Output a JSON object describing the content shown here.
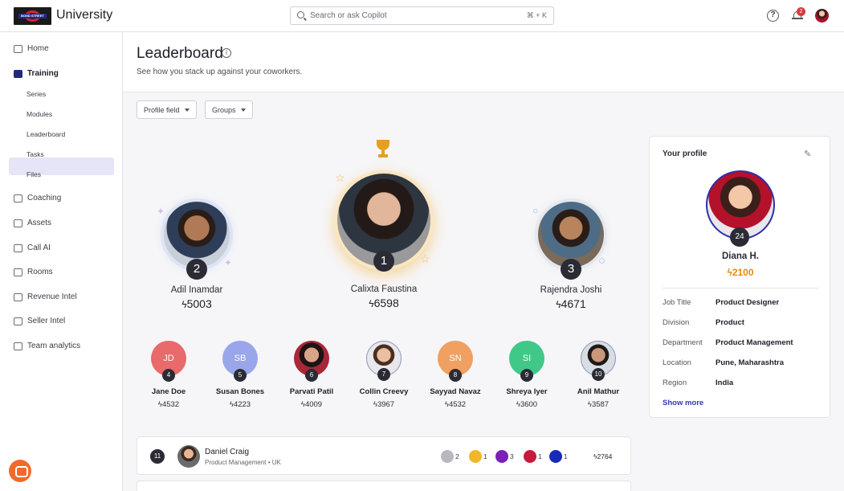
{
  "app": {
    "logo_text": "BOND STREET",
    "title": "University"
  },
  "search": {
    "placeholder": "Search or ask Copilot",
    "shortcut": "⌘ + K"
  },
  "header": {
    "notifications_count": "2",
    "help_label": "?"
  },
  "sidebar": {
    "items": [
      {
        "label": "Home",
        "icon": "home-icon"
      },
      {
        "label": "Training",
        "icon": "graduation-cap-icon"
      },
      {
        "label": "Coaching",
        "icon": "coaching-icon"
      },
      {
        "label": "Assets",
        "icon": "file-icon"
      },
      {
        "label": "Call AI",
        "icon": "audio-wave-icon"
      },
      {
        "label": "Rooms",
        "icon": "door-icon"
      },
      {
        "label": "Revenue Intel",
        "icon": "chart-icon"
      },
      {
        "label": "Seller Intel",
        "icon": "id-card-icon"
      },
      {
        "label": "Team analytics",
        "icon": "bar-chart-icon"
      }
    ],
    "training_sub": [
      "Series",
      "Modules",
      "Leaderboard",
      "Tasks",
      "Files"
    ]
  },
  "page": {
    "title": "Leaderboard",
    "subtitle": "See how you stack up against your coworkers."
  },
  "filters": {
    "profile_field": "Profile field",
    "groups": "Groups"
  },
  "podium": [
    {
      "rank": "2",
      "name": "Adil Inamdar",
      "score": "5003"
    },
    {
      "rank": "1",
      "name": "Calixta Faustina",
      "score": "6598"
    },
    {
      "rank": "3",
      "name": "Rajendra Joshi",
      "score": "4671"
    }
  ],
  "ranked": [
    {
      "rank": "4",
      "initials": "JD",
      "name": "Jane Doe",
      "score": "4532",
      "color": "#e86a6a"
    },
    {
      "rank": "5",
      "initials": "SB",
      "name": "Susan Bones",
      "score": "4223",
      "color": "#9aa6ea"
    },
    {
      "rank": "6",
      "initials": "",
      "name": "Parvati Patil",
      "score": "4009",
      "color": "#7a2a3a"
    },
    {
      "rank": "7",
      "initials": "",
      "name": "Collin Creevy",
      "score": "3967",
      "color": "#c9a58a"
    },
    {
      "rank": "8",
      "initials": "SN",
      "name": "Sayyad Navaz",
      "score": "4532",
      "color": "#f0a060"
    },
    {
      "rank": "9",
      "initials": "SI",
      "name": "Shreya Iyer",
      "score": "3600",
      "color": "#40c888"
    },
    {
      "rank": "10",
      "initials": "",
      "name": "Anil Mathur",
      "score": "3587",
      "color": "#5a6a7a"
    }
  ],
  "list_row": {
    "rank": "11",
    "name": "Daniel Craig",
    "department": "Product Management",
    "separator": "•",
    "region": "UK",
    "medals": [
      {
        "count": "2",
        "color": "#b8b8c0"
      },
      {
        "count": "1",
        "color": "#f0b829"
      },
      {
        "count": "3",
        "color": "#7a1fb8"
      },
      {
        "count": "1",
        "color": "#c81a3a"
      },
      {
        "count": "1",
        "color": "#1a2ab8"
      }
    ],
    "score": "2764"
  },
  "profile": {
    "title": "Your profile",
    "rank": "24",
    "name": "Diana H.",
    "score": "2100",
    "fields": [
      {
        "label": "Job Title",
        "value": "Product Designer"
      },
      {
        "label": "Division",
        "value": "Product"
      },
      {
        "label": "Department",
        "value": "Product Management"
      },
      {
        "label": "Location",
        "value": "Pune, Maharashtra"
      },
      {
        "label": "Region",
        "value": "India"
      }
    ],
    "show_more": "Show more"
  },
  "colors": {
    "accent": "#2f38b8",
    "score_orange": "#e58a14",
    "sidebar_active": "#e5e5f7"
  }
}
